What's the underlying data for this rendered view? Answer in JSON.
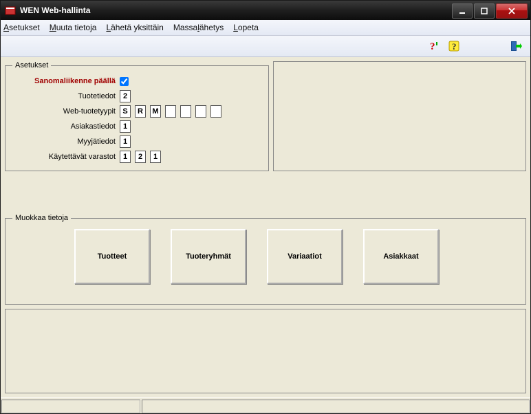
{
  "window": {
    "title": "WEN  Web-hallinta"
  },
  "menu": {
    "items": [
      {
        "prefix": "A",
        "rest": "setukset"
      },
      {
        "prefix": "M",
        "rest": "uuta tietoja"
      },
      {
        "prefix": "L",
        "rest": "ähetä yksittäin"
      },
      {
        "prefix": "",
        "rest": "Massa",
        "mid": "l",
        "tail": "ähetys"
      },
      {
        "prefix": "L",
        "rest": "opeta"
      }
    ]
  },
  "settings": {
    "legend": "Asetukset",
    "rows": {
      "r1": {
        "label": "Sanomaliikenne päällä",
        "checked": true
      },
      "r2": {
        "label": "Tuotetiedot",
        "value": "2"
      },
      "r3": {
        "label": "Web-tuotetyypit",
        "values": [
          "S",
          "R",
          "M",
          "",
          "",
          "",
          ""
        ]
      },
      "r4": {
        "label": "Asiakastiedot",
        "value": "1"
      },
      "r5": {
        "label": "Myyjätiedot",
        "value": "1"
      },
      "r6": {
        "label": "Käytettävät varastot",
        "values": [
          "1",
          "2",
          "1"
        ]
      }
    }
  },
  "edit": {
    "legend": "Muokkaa tietoja",
    "buttons": [
      "Tuotteet",
      "Tuoteryhmät",
      "Variaatiot",
      "Asiakkaat"
    ]
  }
}
